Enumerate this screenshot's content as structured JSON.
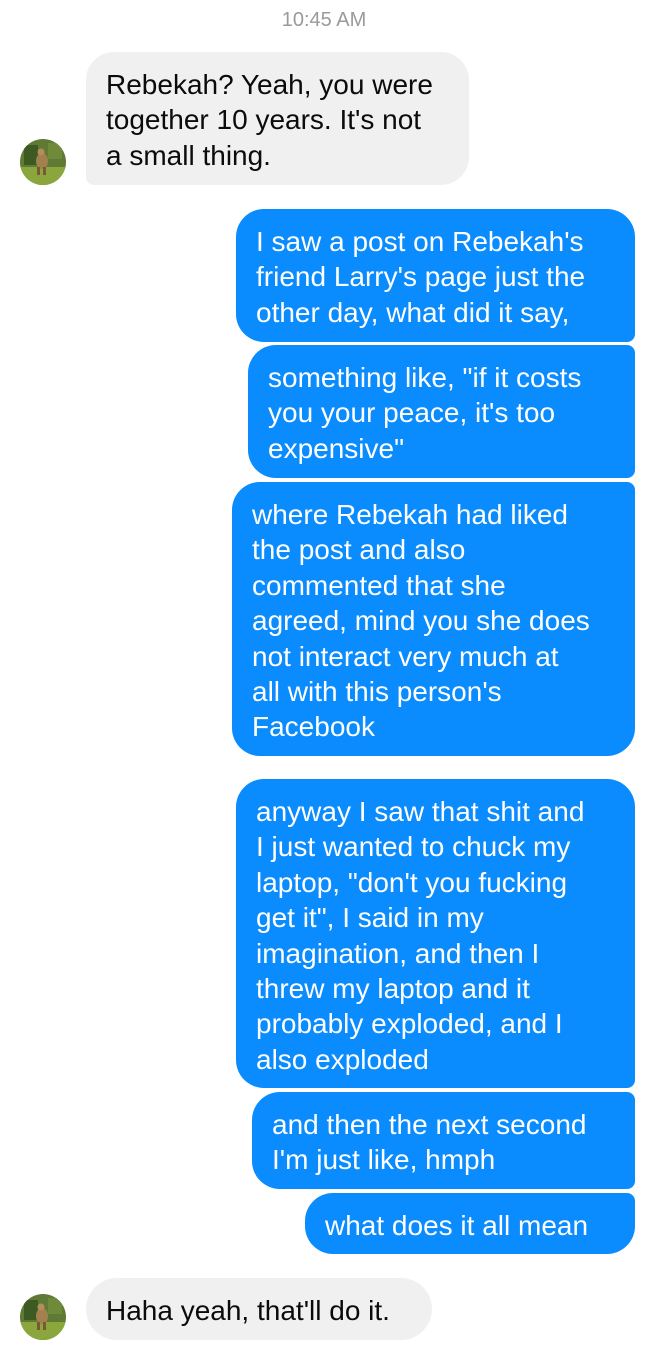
{
  "chat": {
    "timestamp": "10:45 AM",
    "messages": [
      {
        "sender": "other",
        "lines": [
          "Rebekah? Yeah, you were",
          "together 10 years. It's not",
          "a small thing."
        ]
      },
      {
        "sender": "me",
        "lines": [
          "I saw a post on Rebekah's",
          "friend Larry's page just the",
          "other day, what did it say,"
        ]
      },
      {
        "sender": "me",
        "lines": [
          "something like, \"if it costs",
          "you your peace, it's too",
          "expensive\""
        ]
      },
      {
        "sender": "me",
        "lines": [
          "where Rebekah had liked",
          "the post and also",
          "commented that she",
          "agreed, mind you she does",
          "not interact very much at",
          "all with this person's",
          "Facebook"
        ]
      },
      {
        "sender": "me",
        "lines": [
          "anyway I saw that shit and",
          "I just wanted to chuck my",
          "laptop, \"don't you fucking",
          "get it\", I said in my",
          "imagination, and then I",
          "threw my laptop and it",
          "probably exploded, and I",
          "also exploded"
        ]
      },
      {
        "sender": "me",
        "lines": [
          "and then the next second",
          "I'm just like, hmph"
        ]
      },
      {
        "sender": "me",
        "lines": [
          "what does it all mean"
        ]
      },
      {
        "sender": "other",
        "lines": [
          "Haha yeah, that'll do it."
        ]
      }
    ]
  },
  "colors": {
    "outgoing_bubble": "#0a8bfe",
    "incoming_bubble": "#f0f0f0",
    "timestamp_text": "#9a9a9a"
  },
  "icons": {
    "avatar": "contact-avatar-photo"
  }
}
